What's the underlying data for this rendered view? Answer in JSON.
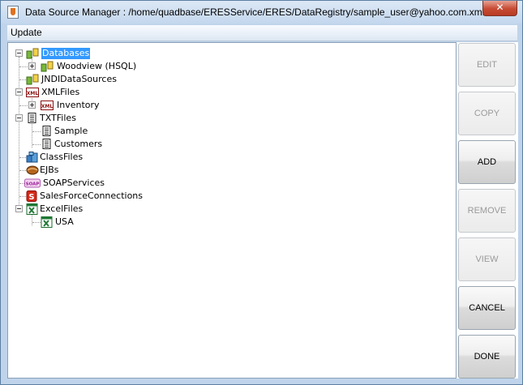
{
  "window": {
    "title": "Data Source Manager : /home/quadbase/ERESService/ERES/DataRegistry/sample_user@yahoo.com.xml",
    "close_label": "✕"
  },
  "menubar": {
    "update": "Update"
  },
  "tree": {
    "databases": "Databases",
    "woodview": "Woodview (HSQL)",
    "jndi": "JNDIDataSources",
    "xmlfiles": "XMLFiles",
    "inventory": "Inventory",
    "txtfiles": "TXTFiles",
    "sample": "Sample",
    "customers": "Customers",
    "classfiles": "ClassFiles",
    "ejbs": "EJBs",
    "soap": "SOAPServices",
    "salesforce": "SalesForceConnections",
    "excelfiles": "ExcelFiles",
    "usa": "USA"
  },
  "icons": {
    "xml_badge": "XML",
    "soap_badge": "SOAP",
    "salesforce_badge": "S"
  },
  "buttons": {
    "edit": "EDIT",
    "copy": "COPY",
    "add": "ADD",
    "remove": "REMOVE",
    "view": "VIEW",
    "cancel": "CANCEL",
    "done": "DONE"
  }
}
